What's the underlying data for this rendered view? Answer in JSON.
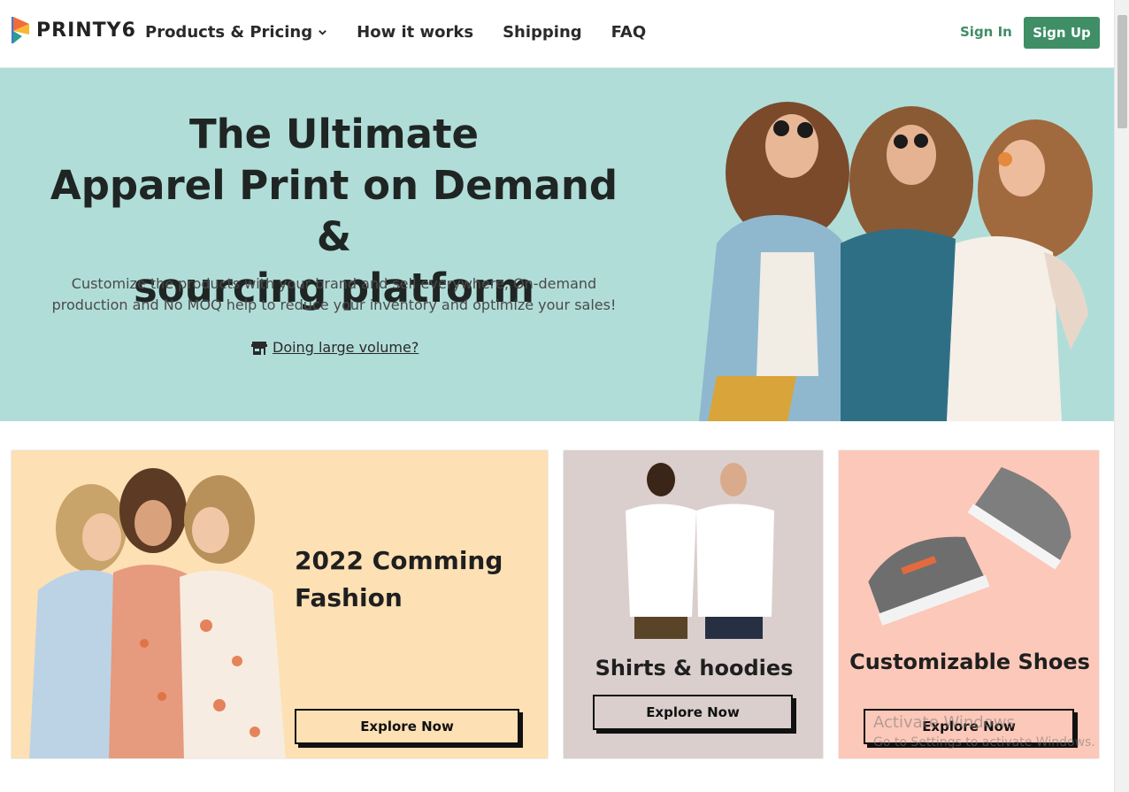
{
  "header": {
    "logo_text": "PRINTY6",
    "nav": [
      {
        "label": "Products & Pricing",
        "has_dropdown": true
      },
      {
        "label": "How it works"
      },
      {
        "label": "Shipping"
      },
      {
        "label": "FAQ"
      }
    ],
    "signin_label": "Sign In",
    "signup_label": "Sign Up"
  },
  "hero": {
    "title_line1": "The Ultimate",
    "title_line2": "Apparel Print on Demand &",
    "title_line3": "sourcing platform",
    "subtitle": "Customize the products with your brand and sell everywhere, On-demand production and No MOQ help to reduce your inventory and optimize your sales!",
    "link_label": "Doing large volume?",
    "link_icon": "store-icon"
  },
  "cards": [
    {
      "title": "2022 Comming Fashion",
      "button": "Explore Now",
      "bg": "#fde0b4"
    },
    {
      "title": "Shirts & hoodies",
      "button": "Explore Now",
      "bg": "#dacfcd"
    },
    {
      "title": "Customizable Shoes",
      "button": "Explore Now",
      "bg": "#fcc8b9"
    }
  ],
  "watermark": {
    "line1": "Activate Windows",
    "line2": "Go to Settings to activate Windows."
  },
  "colors": {
    "brand_green": "#3f8e66",
    "hero_bg": "#b1ddd9"
  }
}
